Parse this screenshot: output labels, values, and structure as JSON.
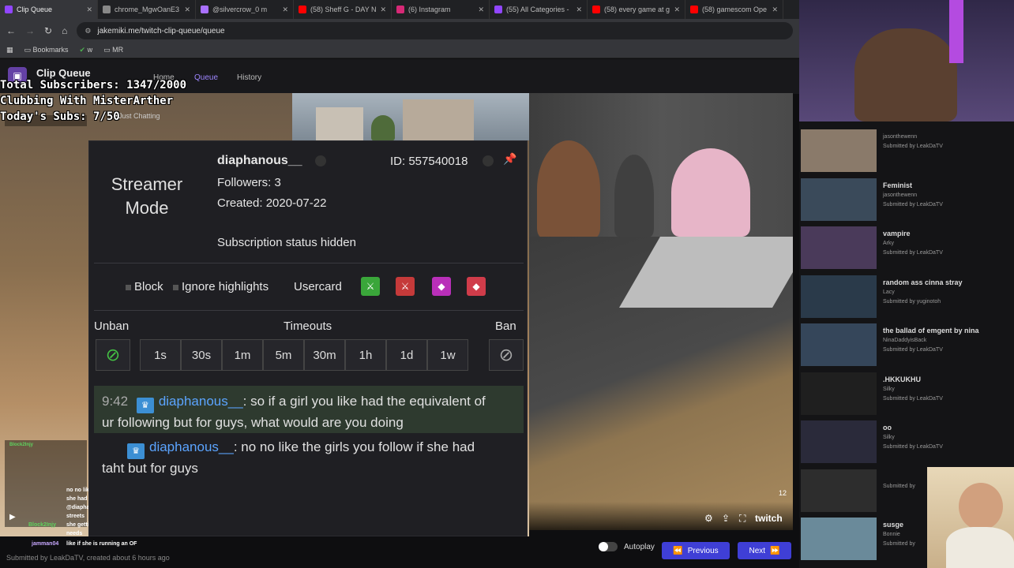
{
  "browser": {
    "tabs": [
      {
        "label": "Clip Queue",
        "color": "#9146ff"
      },
      {
        "label": "chrome_MgwOanE3",
        "color": "#888888"
      },
      {
        "label": "@silvercrow_0 m",
        "color": "#a970ff"
      },
      {
        "label": "(58) Sheff G - DAY N",
        "color": "#ff0000"
      },
      {
        "label": "(6) Instagram",
        "color": "#d62976"
      },
      {
        "label": "(55) All Categories -",
        "color": "#9146ff"
      },
      {
        "label": "(58) every game at g",
        "color": "#ff0000"
      },
      {
        "label": "(58) gamescom Ope",
        "color": "#ff0000"
      }
    ],
    "url": "jakemiki.me/twitch-clip-queue/queue",
    "bookmarks": [
      "Bookmarks",
      "w",
      "MR"
    ]
  },
  "app": {
    "title": "Clip Queue",
    "nav": [
      "Home",
      "Queue",
      "History"
    ],
    "category": "Just Chatting"
  },
  "overlay": {
    "total_subs": "Total Subscribers: 1347/2000",
    "clubbing": "Clubbing With MisterArther",
    "todays_subs": "Today's Subs: 7/50"
  },
  "usercard": {
    "streamer_mode_line1": "Streamer",
    "streamer_mode_line2": "Mode",
    "username": "diaphanous__",
    "followers": "Followers: 3",
    "created": "Created: 2020-07-22",
    "id": "ID: 557540018",
    "sub_status": "Subscription status hidden",
    "block_label": "Block",
    "ignore_label": "Ignore highlights",
    "usercard_label": "Usercard",
    "unban_label": "Unban",
    "timeouts_label": "Timeouts",
    "ban_label": "Ban",
    "timeouts": [
      "1s",
      "30s",
      "1m",
      "5m",
      "30m",
      "1h",
      "1d",
      "1w"
    ],
    "badge_colors": [
      "#3aa63a",
      "#c53a3a",
      "#b92fb9",
      "#d03c4a"
    ],
    "messages": [
      {
        "time": "9:42",
        "user": "diaphanous__",
        "text1": ": so if a girl you like had the equivalent of",
        "text2": "ur following but for guys, what would are you doing"
      },
      {
        "user": "diaphanous__",
        "text1": ": no no like the girls you follow if she had",
        "text2": "taht but for guys"
      }
    ]
  },
  "side_chat": [
    "no no like the girls you follow if",
    "she had taht but for guys",
    "@diaphanous__ she is for the",
    "streets",
    "she getting all the attention she",
    "needs",
    "like if she is running an OF"
  ],
  "side_chat_users": [
    "Block2Injy",
    "jamman04"
  ],
  "submitted_line": "Submitted by LeakDaTV, created about 6 hours ago",
  "clips": [
    {
      "title": "",
      "author": "jasonthewenn",
      "submitter": "Submitted by LeakDaTV"
    },
    {
      "title": "Feminist",
      "author": "jasonthewenn",
      "submitter": "Submitted by LeakDaTV"
    },
    {
      "title": "vampire",
      "author": "Arky",
      "submitter": "Submitted by LeakDaTV"
    },
    {
      "title": "random ass cinna stray",
      "author": "Lacy",
      "submitter": "Submitted by yuginotoh"
    },
    {
      "title": "the ballad of emgent by nina",
      "author": "NinaDaddyisBack",
      "submitter": "Submitted by LeakDaTV"
    },
    {
      "title": ".HKKUKHU",
      "author": "Silky",
      "submitter": "Submitted by LeakDaTV"
    },
    {
      "title": "oo",
      "author": "Silky",
      "submitter": "Submitted by LeakDaTV"
    },
    {
      "title": "",
      "author": "",
      "submitter": "Submitted by"
    },
    {
      "title": "susge",
      "author": "Bonnie",
      "submitter": "Submitted by"
    }
  ],
  "player": {
    "autoplay_label": "Autoplay",
    "previous_label": "Previous",
    "next_label": "Next",
    "volume_level": "12",
    "brand": "twitch"
  }
}
